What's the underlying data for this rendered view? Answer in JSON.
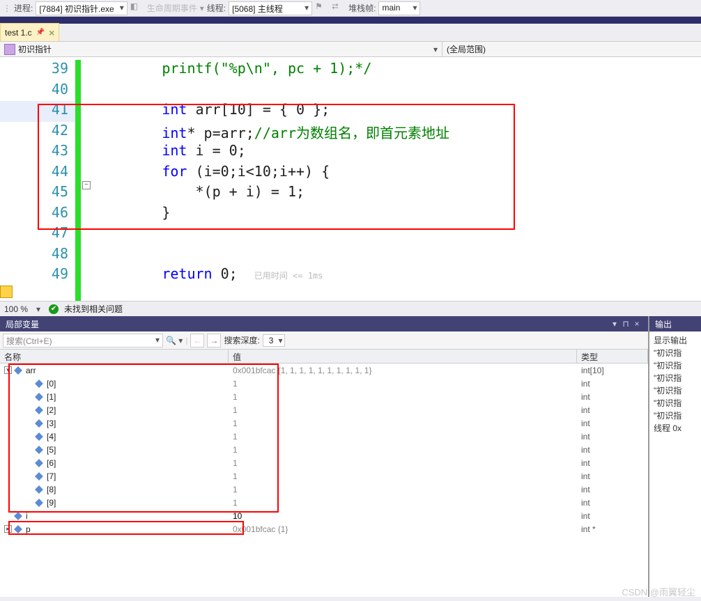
{
  "toolbar": {
    "process_lbl": "进程:",
    "process_val": "[7884] 初识指针.exe",
    "lifecycle_lbl": "生命周期事件",
    "thread_lbl": "线程:",
    "thread_val": "[5068] 主线程",
    "stack_lbl": "堆栈帧:",
    "stack_val": "main"
  },
  "tab": {
    "name": "test 1.c",
    "pin": "📌",
    "close": "×"
  },
  "nav": {
    "left": "初识指针",
    "right": "(全局范围)"
  },
  "editor": {
    "lines": [
      "39",
      "40",
      "41",
      "42",
      "43",
      "44",
      "45",
      "46",
      "47",
      "48",
      "49"
    ],
    "c39": "        printf(\"%p\\n\", pc + 1);*/",
    "c40": "",
    "c41_a": "        int",
    "c41_b": " arr[10] = { 0 };",
    "c42_a": "        int",
    "c42_b": "* p=arr;",
    "c42_c": "//arr为数组名，即首元素地址",
    "c43_a": "        int",
    "c43_b": " i = 0;",
    "c44_a": "        for",
    "c44_b": " (i=0;i<10;i++) {",
    "c45": "            *(p + i) = 1;",
    "c46": "        }",
    "c47": "",
    "c48": "",
    "c49_a": "        return",
    "c49_b": " 0;  ",
    "c49_hint": "已用时间 <= 1ms"
  },
  "status": {
    "zoom": "100 %",
    "msg": "未找到相关问题"
  },
  "localsPanel": {
    "title": "局部变量",
    "search_ph": "搜索(Ctrl+E)",
    "depth_lbl": "搜索深度:",
    "depth_val": "3",
    "cols": {
      "name": "名称",
      "value": "值",
      "type": "类型"
    },
    "rows": [
      {
        "exp": "open",
        "ind": 0,
        "name": "arr",
        "val": "0x001bfcac {1, 1, 1, 1, 1, 1, 1, 1, 1, 1}",
        "type": "int[10]"
      },
      {
        "exp": "",
        "ind": 1,
        "name": "[0]",
        "val": "1",
        "type": "int"
      },
      {
        "exp": "",
        "ind": 1,
        "name": "[1]",
        "val": "1",
        "type": "int"
      },
      {
        "exp": "",
        "ind": 1,
        "name": "[2]",
        "val": "1",
        "type": "int"
      },
      {
        "exp": "",
        "ind": 1,
        "name": "[3]",
        "val": "1",
        "type": "int"
      },
      {
        "exp": "",
        "ind": 1,
        "name": "[4]",
        "val": "1",
        "type": "int"
      },
      {
        "exp": "",
        "ind": 1,
        "name": "[5]",
        "val": "1",
        "type": "int"
      },
      {
        "exp": "",
        "ind": 1,
        "name": "[6]",
        "val": "1",
        "type": "int"
      },
      {
        "exp": "",
        "ind": 1,
        "name": "[7]",
        "val": "1",
        "type": "int"
      },
      {
        "exp": "",
        "ind": 1,
        "name": "[8]",
        "val": "1",
        "type": "int"
      },
      {
        "exp": "",
        "ind": 1,
        "name": "[9]",
        "val": "1",
        "type": "int"
      },
      {
        "exp": "",
        "ind": 0,
        "name": "i",
        "val": "10",
        "type": "int"
      },
      {
        "exp": "closed",
        "ind": 0,
        "name": "p",
        "val": "0x001bfcac {1}",
        "type": "int *"
      }
    ]
  },
  "outputPanel": {
    "title": "输出",
    "header_lbl": "显示输出",
    "lines": [
      "\"初识指",
      "\"初识指",
      "\"初识指",
      "\"初识指",
      "\"初识指",
      "\"初识指",
      "线程 0x"
    ]
  },
  "watermark": "CSDN @雨翼轻尘"
}
